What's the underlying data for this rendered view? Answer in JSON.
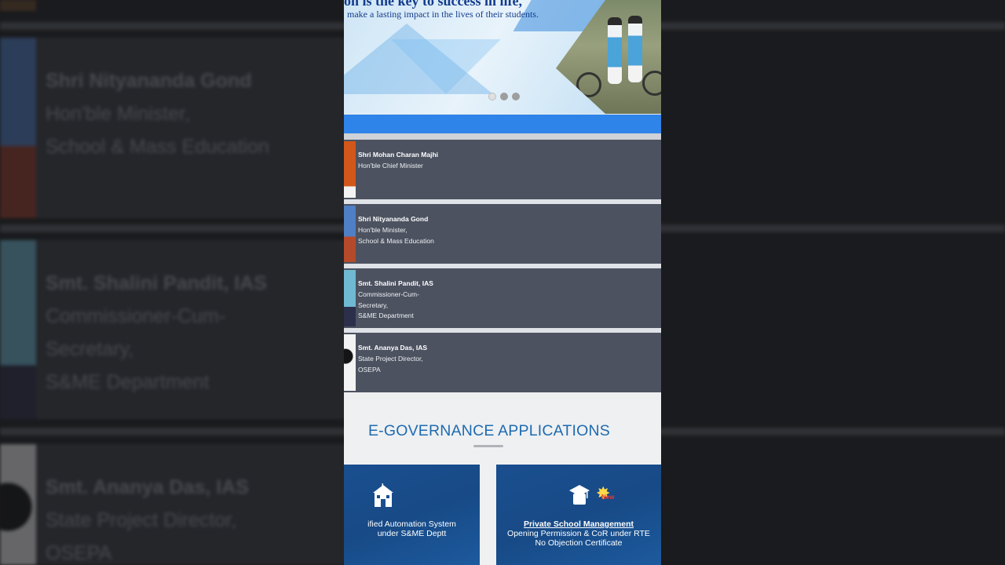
{
  "banner": {
    "title": "on is the key to success in life,",
    "subtitle": "make a lasting impact in the lives of their students.",
    "slides": 3,
    "active_slide": 1
  },
  "people": [
    {
      "name": "Shri Mohan Charan Majhi",
      "role_lines": [
        "Hon'ble Chief Minister"
      ],
      "photo_color": "#d2571a"
    },
    {
      "name": "Shri Nityananda Gond",
      "role_lines": [
        "Hon'ble Minister,",
        "School & Mass Education"
      ],
      "photo_color": "#4f7fc4"
    },
    {
      "name": "Smt. Shalini Pandit, IAS",
      "role_lines": [
        "Commissioner-Cum-",
        "Secretary,",
        "S&ME Department"
      ],
      "photo_color": "#6fb9d3"
    },
    {
      "name": "Smt. Ananya Das, IAS",
      "role_lines": [
        "State Project Director,",
        "OSEPA"
      ],
      "photo_color": "#f2f2f2"
    }
  ],
  "background": {
    "people": [
      {
        "name": "Shri Nityananda Gond",
        "role_lines": [
          "Hon'ble Minister,",
          "School & Mass Education"
        ]
      },
      {
        "name": "Smt. Shalini Pandit, IAS",
        "role_lines": [
          "Commissioner-Cum-",
          "Secretary,",
          "S&ME Department"
        ]
      },
      {
        "name": "Smt. Ananya Das, IAS",
        "role_lines": [
          "State Project Director,",
          "OSEPA"
        ]
      }
    ]
  },
  "egov": {
    "title": "E-GOVERNANCE APPLICATIONS",
    "cards": [
      {
        "icon": "school-building-icon",
        "title": "",
        "lines": [
          "ified Automation System",
          "under S&ME Deptt"
        ]
      },
      {
        "icon": "graduation-cap-icon",
        "title": "Private School Management",
        "lines": [
          "Opening Permission & CoR under RTE",
          "No Objection Certificate"
        ],
        "badge": "New"
      }
    ]
  },
  "colors": {
    "accent_blue": "#2f84ea",
    "card_blue": "#1a4f8f",
    "person_card": "#4c5260",
    "egov_title": "#1f6bb0"
  }
}
